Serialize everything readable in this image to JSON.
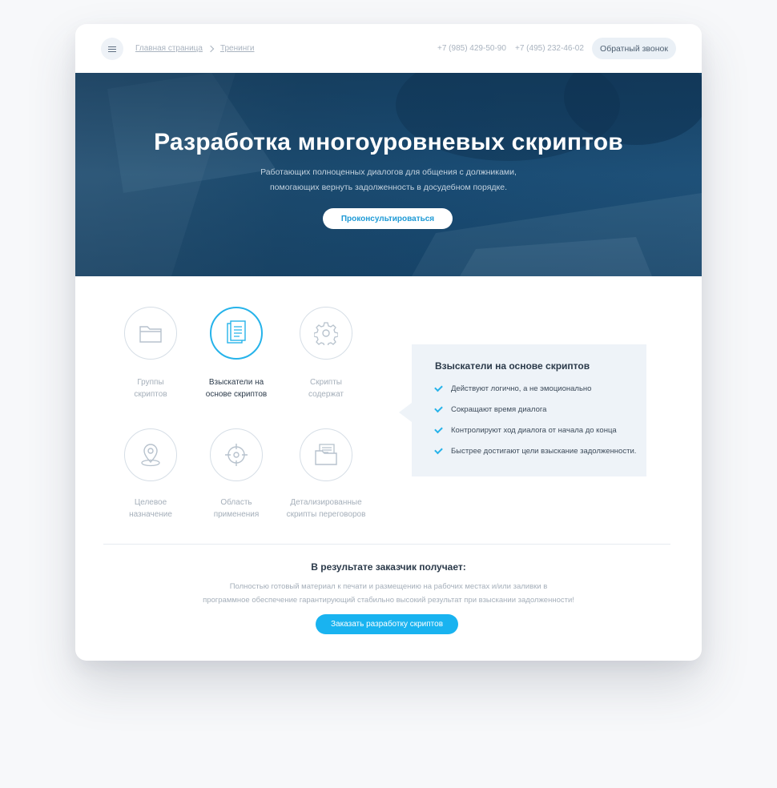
{
  "header": {
    "breadcrumbs": [
      "Главная страница",
      "Тренинги"
    ],
    "phones": [
      "+7 (985) 429-50-90",
      "+7 (495) 232-46-02"
    ],
    "callback_label": "Обратный звонок"
  },
  "hero": {
    "title": "Разработка многоуровневых скриптов",
    "subtitle_line1": "Работающих полноценных диалогов для общения с должниками,",
    "subtitle_line2": "помогающих вернуть задолженность в досудебном порядке.",
    "button_label": "Проконсультироваться"
  },
  "features": [
    {
      "line1": "Группы",
      "line2": "скриптов",
      "icon": "folder-icon",
      "active": false
    },
    {
      "line1": "Взыскатели на",
      "line2": "основе скриптов",
      "icon": "document-icon",
      "active": true
    },
    {
      "line1": "Скрипты",
      "line2": "содержат",
      "icon": "gear-icon",
      "active": false
    },
    {
      "line1": "Целевое",
      "line2": "назначение",
      "icon": "location-pin-icon",
      "active": false
    },
    {
      "line1": "Область",
      "line2": "применения",
      "icon": "crosshair-icon",
      "active": false
    },
    {
      "line1": "Детализированные",
      "line2": "скрипты переговоров",
      "icon": "files-icon",
      "active": false
    }
  ],
  "info": {
    "title": "Взыскатели на основе скриптов",
    "items": [
      "Действуют логично, а не эмоционально",
      "Сокращают время диалога",
      "Контролируют ход диалога от начала до конца",
      "Быстрее достигают цели взыскание задолженности."
    ]
  },
  "result": {
    "title": "В результате заказчик получает:",
    "text_line1": "Полностью готовый материал к печати и размещению на рабочих местах и/или заливки в",
    "text_line2": "программное обеспечение гарантирующий стабильно высокий результат при взыскании задолженности!",
    "button_label": "Заказать разработку скриптов"
  },
  "colors": {
    "accent": "#26b3ea",
    "hero_bg": "#1d4d72",
    "info_bg": "#eef3f8"
  }
}
